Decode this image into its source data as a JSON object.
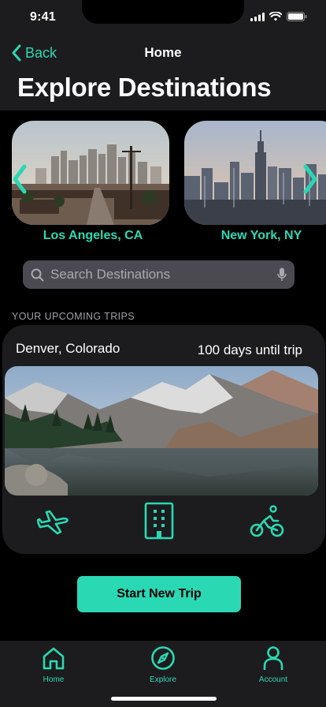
{
  "status": {
    "time": "9:41"
  },
  "nav": {
    "back_label": "Back",
    "title": "Home"
  },
  "page": {
    "title": "Explore Destinations"
  },
  "carousel": {
    "items": [
      {
        "label": "Los Angeles, CA"
      },
      {
        "label": "New York, NY"
      }
    ]
  },
  "search": {
    "placeholder": "Search Destinations"
  },
  "trips": {
    "heading": "YOUR UPCOMING TRIPS",
    "city": "Denver, Colorado",
    "countdown": "100 days until trip"
  },
  "actions": {
    "start_label": "Start New Trip"
  },
  "tabs": [
    {
      "label": "Home",
      "icon": "home-icon"
    },
    {
      "label": "Explore",
      "icon": "compass-icon"
    },
    {
      "label": "Account",
      "icon": "person-icon"
    }
  ],
  "colors": {
    "accent": "#2ad8b4",
    "surface": "#1c1c1e",
    "background": "#000000"
  }
}
